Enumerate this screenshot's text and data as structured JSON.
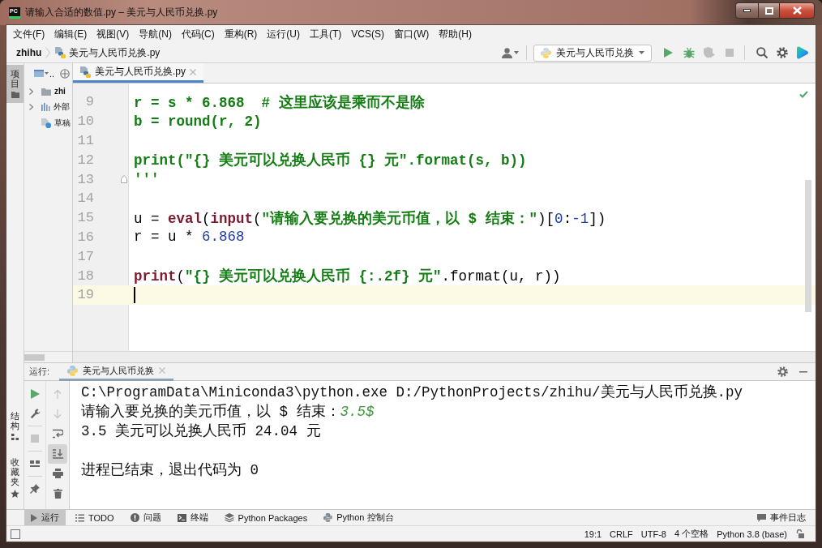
{
  "window": {
    "logo": "PC",
    "title": "请输入合适的数值.py – 美元与人民币兑换.py"
  },
  "menu": [
    "文件(F)",
    "编辑(E)",
    "视图(V)",
    "导航(N)",
    "代码(C)",
    "重构(R)",
    "运行(U)",
    "工具(T)",
    "VCS(S)",
    "窗口(W)",
    "帮助(H)"
  ],
  "navigation": {
    "breadcrumbs": [
      {
        "label": "zhihu",
        "kind": "project"
      },
      {
        "label": "美元与人民币兑换.py",
        "kind": "file"
      }
    ],
    "run_config": "美元与人民币兑换",
    "actions": [
      {
        "kind": "run",
        "disabled": false
      },
      {
        "kind": "debug",
        "disabled": false
      },
      {
        "kind": "coverage",
        "disabled": true
      },
      {
        "kind": "stop",
        "disabled": true
      }
    ]
  },
  "left_stripe": {
    "top": [
      {
        "label": "项目",
        "kind": "project",
        "selected": true
      }
    ],
    "bottom": [
      {
        "label": "结构",
        "kind": "structure",
        "selected": false
      },
      {
        "label": "收藏夹",
        "kind": "favorites",
        "selected": false
      }
    ]
  },
  "project": {
    "view": "..",
    "tree": [
      {
        "label": "zhi",
        "kind": "folder",
        "expandable": true,
        "expanded": false
      },
      {
        "label": "外部",
        "kind": "library",
        "expandable": true,
        "expanded": false
      },
      {
        "label": "草稿",
        "kind": "scratches",
        "expandable": false
      }
    ]
  },
  "editor": {
    "tabs": [
      {
        "label": "美元与人民币兑换.py",
        "selected": true
      }
    ],
    "lines": [
      {
        "number": "9",
        "fold": false,
        "current": false,
        "tokens": [
          {
            "text": "r = s * 6.868  # 这里应该是乘而不是除",
            "kind": "string"
          }
        ]
      },
      {
        "number": "10",
        "fold": false,
        "current": false,
        "tokens": [
          {
            "text": "b = round(r, 2)",
            "kind": "string"
          }
        ]
      },
      {
        "number": "11",
        "fold": false,
        "current": false
      },
      {
        "number": "12",
        "fold": false,
        "current": false,
        "tokens": [
          {
            "text": "print(\"{} 美元可以兑换人民币 {} 元\".format(s, b))",
            "kind": "string"
          }
        ]
      },
      {
        "number": "13",
        "fold": true,
        "current": false,
        "tokens": [
          {
            "text": "'''",
            "kind": "string"
          }
        ]
      },
      {
        "number": "14",
        "fold": false,
        "current": false
      },
      {
        "number": "15",
        "fold": false,
        "current": false,
        "tokens": [
          {
            "text": "u = ",
            "kind": "plain"
          },
          {
            "text": "eval",
            "kind": "builtin"
          },
          {
            "text": "(",
            "kind": "plain"
          },
          {
            "text": "input",
            "kind": "builtin"
          },
          {
            "text": "(",
            "kind": "plain"
          },
          {
            "text": "\"请输入要兑换的美元币值，以 $ 结束：\"",
            "kind": "string"
          },
          {
            "text": ")[",
            "kind": "plain"
          },
          {
            "text": "0",
            "kind": "number"
          },
          {
            "text": ":",
            "kind": "plain"
          },
          {
            "text": "-1",
            "kind": "number"
          },
          {
            "text": "])",
            "kind": "plain"
          }
        ]
      },
      {
        "number": "16",
        "fold": false,
        "current": false,
        "tokens": [
          {
            "text": "r = u * ",
            "kind": "plain"
          },
          {
            "text": "6.868",
            "kind": "number"
          }
        ]
      },
      {
        "number": "17",
        "fold": false,
        "current": false
      },
      {
        "number": "18",
        "fold": false,
        "current": false,
        "tokens": [
          {
            "text": "print",
            "kind": "builtin"
          },
          {
            "text": "(",
            "kind": "plain"
          },
          {
            "text": "\"{} 美元可以兑换人民币 {:.2f} 元\"",
            "kind": "string"
          },
          {
            "text": ".format(u, r))",
            "kind": "plain"
          }
        ]
      },
      {
        "number": "19",
        "fold": false,
        "current": true
      }
    ]
  },
  "run_panel": {
    "label": "运行:",
    "tabs": [
      {
        "label": "美元与人民币兑换",
        "selected": true
      }
    ],
    "tools_left": [
      {
        "kind": "rerun",
        "disabled": false,
        "separator": false
      },
      {
        "kind": "wrench",
        "disabled": false,
        "separator": false
      },
      {
        "kind": "stop",
        "disabled": true,
        "separator": true
      },
      {
        "kind": "layout",
        "disabled": false,
        "separator": true
      },
      {
        "kind": "pin",
        "disabled": false,
        "separator": true
      }
    ],
    "tools_right": [
      {
        "kind": "up",
        "disabled": true,
        "on": false
      },
      {
        "kind": "down",
        "disabled": true,
        "on": false
      },
      {
        "kind": "wrap",
        "disabled": false,
        "on": false
      },
      {
        "kind": "scroll_end",
        "disabled": false,
        "on": true
      },
      {
        "kind": "print",
        "disabled": false,
        "on": false
      },
      {
        "kind": "clear",
        "disabled": false,
        "on": false
      }
    ],
    "console": [
      {
        "kind": "command",
        "segments": [
          {
            "text": "C:\\ProgramData\\Miniconda3\\python.exe D:/PythonProjects/zhihu/美元与人民币兑换.py",
            "kind": "output"
          }
        ]
      },
      {
        "kind": "output",
        "segments": [
          {
            "text": "请输入要兑换的美元币值，以 $ 结束：",
            "kind": "output"
          },
          {
            "text": "3.5$",
            "kind": "input"
          }
        ]
      },
      {
        "kind": "output",
        "segments": [
          {
            "text": "3.5 美元可以兑换人民币 24.04 元",
            "kind": "output"
          }
        ]
      },
      {
        "kind": "exit",
        "segments": [
          {
            "text": "进程已结束，退出代码为 0",
            "kind": "output"
          }
        ]
      }
    ]
  },
  "tool_windows": {
    "left": [
      {
        "label": "运行",
        "kind": "run",
        "selected": true
      },
      {
        "label": "TODO",
        "kind": "todo",
        "selected": false
      },
      {
        "label": "问题",
        "kind": "problems",
        "selected": false
      },
      {
        "label": "终端",
        "kind": "terminal",
        "selected": false
      },
      {
        "label": "Python Packages",
        "kind": "packages",
        "selected": false
      },
      {
        "label": "Python 控制台",
        "kind": "console",
        "selected": false
      }
    ],
    "right": [
      {
        "label": "事件日志",
        "kind": "log",
        "selected": false
      }
    ]
  },
  "status_bar": {
    "items": [
      "19:1",
      "CRLF",
      "UTF-8",
      "4 个空格",
      "Python 3.8 (base)"
    ]
  }
}
